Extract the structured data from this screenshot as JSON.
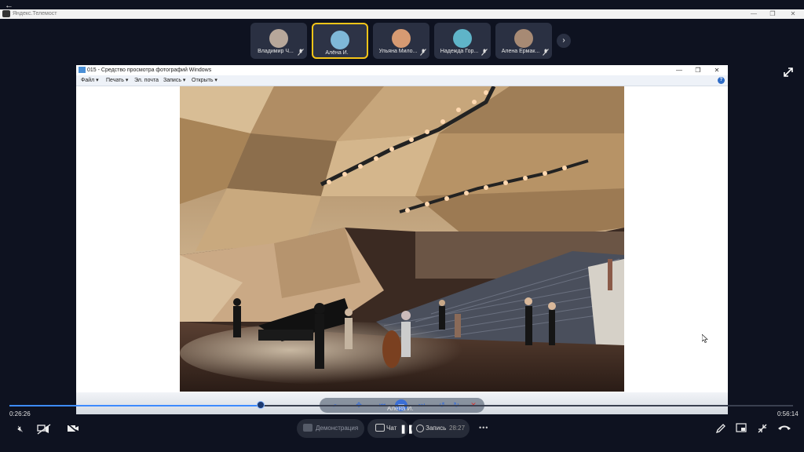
{
  "app": {
    "title": "Яндекс.Телемост",
    "back_glyph": "←",
    "window_controls": [
      "—",
      "❐",
      "✕"
    ]
  },
  "participants": [
    {
      "name": "Владимир Ч...",
      "avatar_color": "#b7a79a",
      "muted": true,
      "active": false
    },
    {
      "name": "Алёна И.",
      "avatar_color": "#7fb8d8",
      "muted": false,
      "active": true
    },
    {
      "name": "Ульяна Мило...",
      "avatar_color": "#d69a72",
      "muted": true,
      "active": false
    },
    {
      "name": "Надежда Гор...",
      "avatar_color": "#5fb4c8",
      "muted": true,
      "active": false
    },
    {
      "name": "Алена Ермак...",
      "avatar_color": "#a78a74",
      "muted": true,
      "active": false
    }
  ],
  "next_glyph": "›",
  "viewer": {
    "title": "015 - Средство просмотра фотографий Windows",
    "menu": [
      "Файл ▾",
      "Печать ▾",
      "Эл. почта",
      "Запись ▾",
      "Открыть ▾"
    ],
    "help": "?",
    "window_controls": [
      "—",
      "❐",
      "✕"
    ],
    "toolbar_hover_label": "Алёна И."
  },
  "playback": {
    "current_time": "0:26:26",
    "total_time": "0:56:14",
    "progress": 0.321
  },
  "controls": {
    "demo_label": "Демонстрация",
    "chat_label": "Чат",
    "record_label": "Запись",
    "record_time": "28:27",
    "more_glyph": "•••"
  },
  "colors": {
    "accent": "#3d8bff",
    "active_border": "#f5c518",
    "background": "#0e1220"
  }
}
